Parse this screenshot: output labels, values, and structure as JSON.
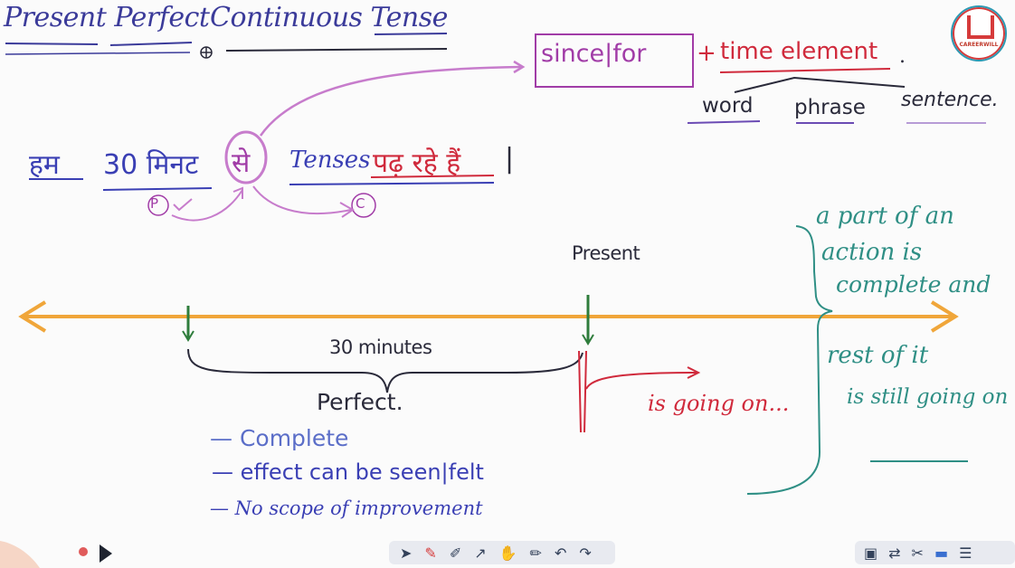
{
  "title": {
    "part1": "Present Perfect",
    "part2": "Continuous Tense"
  },
  "logo": {
    "name": "CAREERWILL"
  },
  "formula": {
    "since_for": "since|for",
    "plus": "+",
    "time_element": "time element",
    "dot": "."
  },
  "element_types": [
    "word",
    "phrase",
    "sentence."
  ],
  "hindi_sentence": {
    "w1": "हम",
    "w2": "30 मिनट",
    "w3": "से",
    "w4": "Tenses",
    "w5": "पढ़ रहे हैं",
    "end": "|"
  },
  "markers": {
    "p": "P",
    "c": "C"
  },
  "timeline": {
    "present_label": "Present",
    "duration": "30 minutes",
    "going_on": "is going on..."
  },
  "perfect_notes": {
    "heading": "Perfect.",
    "items": [
      "— Complete",
      "— effect can be seen|felt",
      "— No scope of improvement"
    ]
  },
  "explanation": {
    "lines": [
      "a part of an",
      "action is",
      "complete and",
      "rest of it",
      "is still going on"
    ]
  },
  "toolbar": {
    "icons": [
      "cursor-icon",
      "pen-icon",
      "highlighter-icon",
      "arrow-icon",
      "hand-icon",
      "draw-icon",
      "undo-icon",
      "redo-icon"
    ]
  },
  "toolbar2": {
    "icons": [
      "image-icon",
      "swap-icon",
      "tools-icon",
      "window-icon",
      "menu-icon"
    ]
  },
  "colors": {
    "timeline": "#f0a63a",
    "present": "#2f7d3c",
    "red": "#d02a3c",
    "purple": "#a13ca7",
    "teal": "#2f8f85",
    "blue": "#3a3fb4"
  }
}
